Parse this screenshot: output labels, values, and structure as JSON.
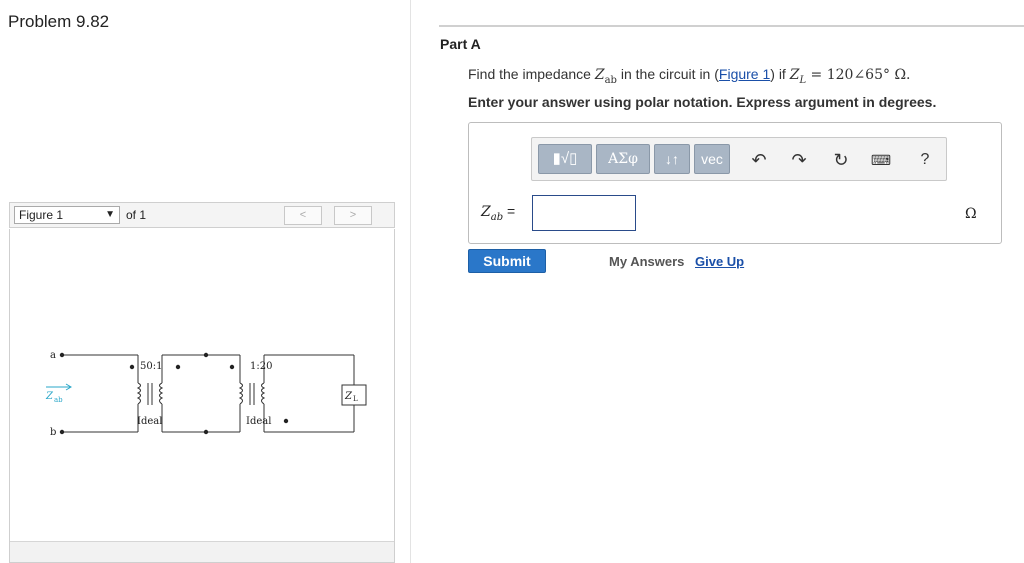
{
  "problem": {
    "title": "Problem 9.82"
  },
  "figure": {
    "selector_label": "Figure 1",
    "of_label": "of 1",
    "prev_label": "<",
    "next_label": ">",
    "circuit": {
      "terminal_a": "a",
      "terminal_b": "b",
      "zab_label": "Z",
      "zab_sub": "ab",
      "t1_ratio": "50:1",
      "t1_type": "Ideal",
      "t2_ratio": "1:20",
      "t2_type": "Ideal",
      "load_label": "Z",
      "load_sub": "L"
    }
  },
  "part": {
    "title": "Part A",
    "question_prefix": "Find the impedance ",
    "question_var": "Z",
    "question_var_sub": "ab",
    "question_mid": " in the circuit in (",
    "question_link": "Figure 1",
    "question_mid2": ") if ",
    "question_zl": "Z",
    "question_zl_sub": "L",
    "question_value": " = 120∠65° Ω.",
    "instructions": "Enter your answer using polar notation. Express argument in degrees."
  },
  "toolbar": {
    "templates_label": "▮√▯",
    "symbols_label": "ΑΣφ",
    "updown_label": "↓↑",
    "vec_label": "vec",
    "undo_icon": "undo-icon",
    "redo_icon": "redo-icon",
    "reset_icon": "reset-icon",
    "keyboard_icon": "keyboard-icon",
    "help_label": "?"
  },
  "answer": {
    "label_var": "Z",
    "label_sub": "ab",
    "label_eq": " =",
    "value": "",
    "unit": "Ω"
  },
  "actions": {
    "submit": "Submit",
    "my_answers": "My Answers",
    "give_up": "Give Up"
  }
}
